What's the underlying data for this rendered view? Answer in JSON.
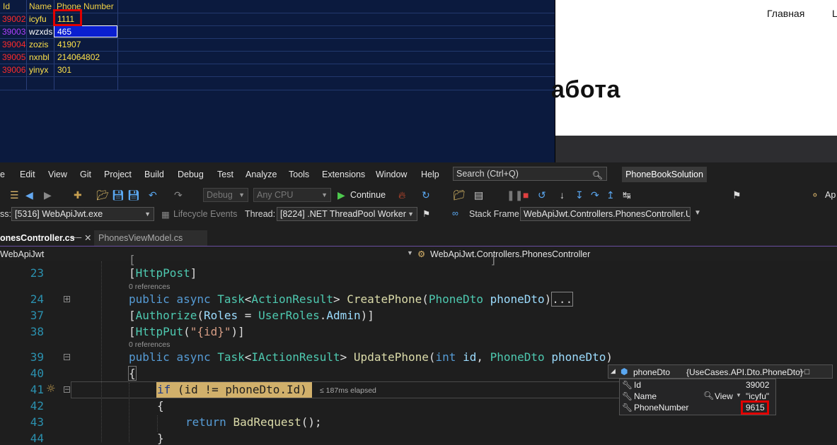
{
  "grid": {
    "headers": [
      "Id",
      "Name",
      "Phone Number"
    ],
    "rows": [
      {
        "id": "39002",
        "name": "icyfu",
        "phone": "1111"
      },
      {
        "id": "39003",
        "name": "wzxds",
        "phone": "465"
      },
      {
        "id": "39004",
        "name": "zozis",
        "phone": "41907"
      },
      {
        "id": "39005",
        "name": "nxnbl",
        "phone": "214064802"
      },
      {
        "id": "39006",
        "name": "yinyx",
        "phone": "301"
      }
    ]
  },
  "web": {
    "nav": [
      "Главная",
      "L"
    ],
    "heading": "абота"
  },
  "menu": [
    "e",
    "Edit",
    "View",
    "Git",
    "Project",
    "Build",
    "Debug",
    "Test",
    "Analyze",
    "Tools",
    "Extensions",
    "Window",
    "Help"
  ],
  "search": {
    "placeholder": "Search (Ctrl+Q)"
  },
  "solution_name": "PhoneBookSolution",
  "toolbar": {
    "config": "Debug",
    "platform": "Any CPU",
    "continue": "Continue",
    "app_label": "Ap"
  },
  "debugbar": {
    "process_label": "ss:",
    "process": "[5316] WebApiJwt.exe",
    "lifecycle": "Lifecycle Events",
    "thread_label": "Thread:",
    "thread": "[8224] .NET ThreadPool Worker",
    "stack_label": "Stack Frame:",
    "stack": "WebApiJwt.Controllers.PhonesController.U"
  },
  "tabs": {
    "active": "onesController.cs",
    "inactive": "PhonesViewModel.cs"
  },
  "navbar": {
    "project": "WebApiJwt",
    "class": "WebApiJwt.Controllers.PhonesController"
  },
  "code": {
    "lines": [
      {
        "n": "23"
      },
      {
        "n": "24"
      },
      {
        "n": "37"
      },
      {
        "n": "38"
      },
      {
        "n": "39"
      },
      {
        "n": "40"
      },
      {
        "n": "41"
      },
      {
        "n": "42"
      },
      {
        "n": "43"
      },
      {
        "n": "44"
      }
    ],
    "refs": "0 references",
    "elapsed": "≤ 187ms elapsed"
  },
  "datatip": {
    "title": "phoneDto",
    "type": "{UseCases.API.Dto.PhoneDto}",
    "fields": [
      {
        "name": "Id",
        "value": "39002"
      },
      {
        "name": "Name",
        "value": "\"icyfu\""
      },
      {
        "name": "PhoneNumber",
        "value": "9615"
      }
    ],
    "view_label": "View"
  }
}
